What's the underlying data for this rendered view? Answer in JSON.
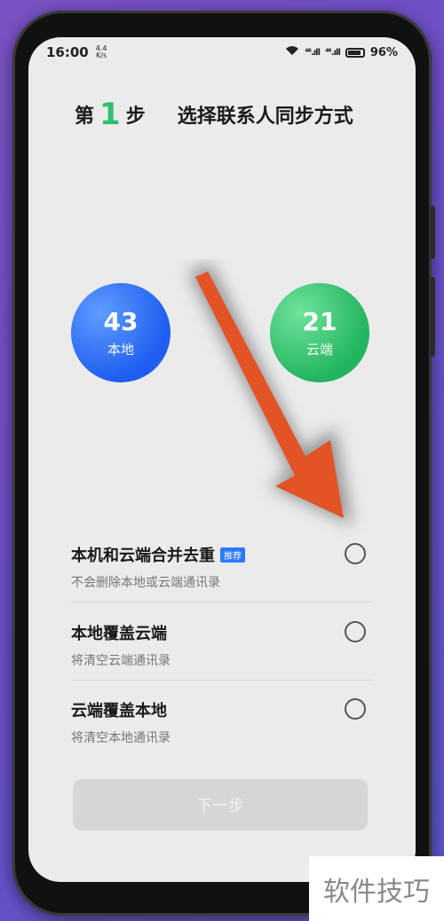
{
  "status_bar": {
    "time": "16:00",
    "net_speed_value": "4.4",
    "net_speed_unit": "K/s",
    "signal_1": "⁴⁶.ıll",
    "signal_2": "⁴⁶.ıll",
    "battery": "96%"
  },
  "header": {
    "prefix": "第",
    "step_number": "1",
    "suffix": "步",
    "title": "选择联系人同步方式"
  },
  "counts": {
    "local": {
      "value": "43",
      "label": "本地",
      "color": "#2f6ff5"
    },
    "cloud": {
      "value": "21",
      "label": "云端",
      "color": "#2dbb66"
    }
  },
  "options": [
    {
      "title": "本机和云端合并去重",
      "badge": "推荐",
      "subtitle": "不会删除本地或云端通讯录"
    },
    {
      "title": "本地覆盖云端",
      "subtitle": "将清空云端通讯录"
    },
    {
      "title": "云端覆盖本地",
      "subtitle": "将清空本地通讯录"
    }
  ],
  "next_button": "下一步",
  "watermark": "软件技巧"
}
